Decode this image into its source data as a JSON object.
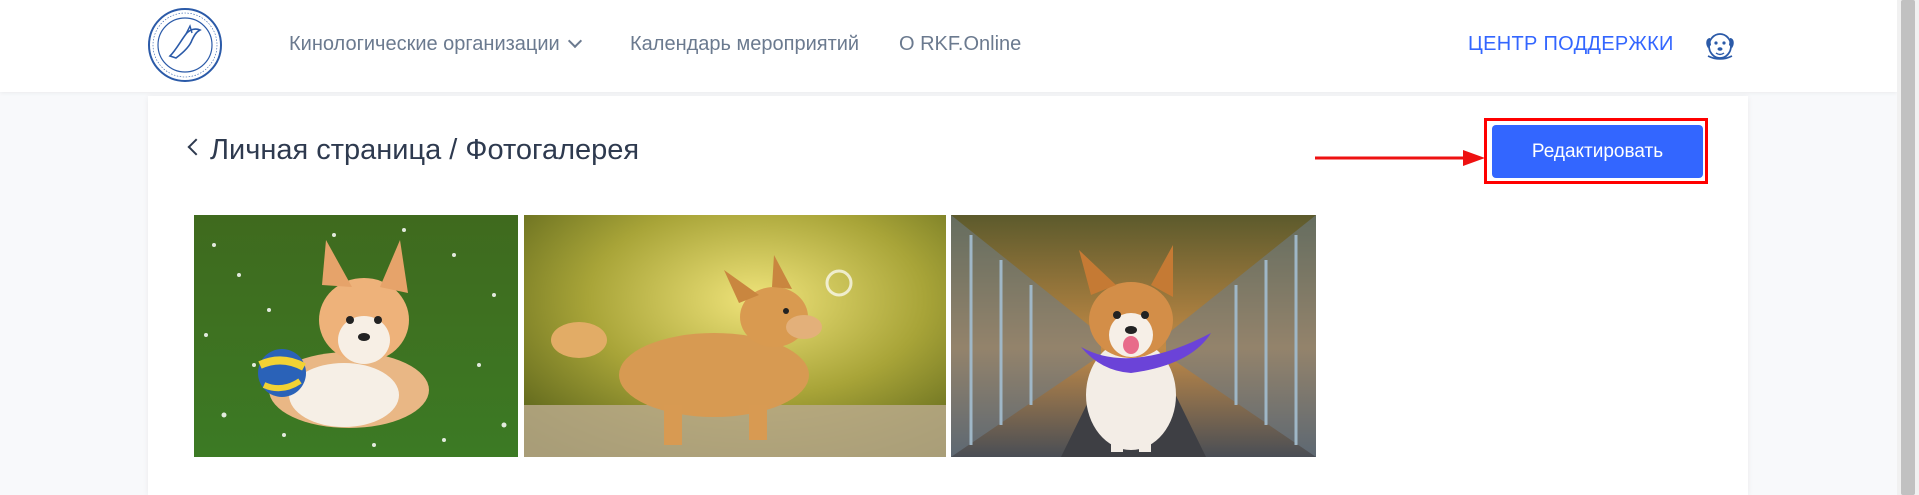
{
  "header": {
    "nav": {
      "orgs": "Кинологические организации",
      "calendar": "Календарь мероприятий",
      "about": "О RKF.Online"
    },
    "support": "ЦЕНТР ПОДДЕРЖКИ",
    "logo_icon": "rkf-logo-icon",
    "avatar_icon": "dog-avatar-icon"
  },
  "page": {
    "breadcrumb": "Личная страница / Фотогалерея",
    "edit_button": "Редактировать"
  },
  "gallery": {
    "photos": [
      {
        "subject": "corgi-puppy-on-grass"
      },
      {
        "subject": "corgi-walking-sunlit"
      },
      {
        "subject": "corgi-with-purple-bandana"
      }
    ]
  },
  "colors": {
    "accent": "#3366ff",
    "highlight": "#ff0000",
    "text": "#2e3a4f",
    "nav": "#6b7a8f"
  }
}
